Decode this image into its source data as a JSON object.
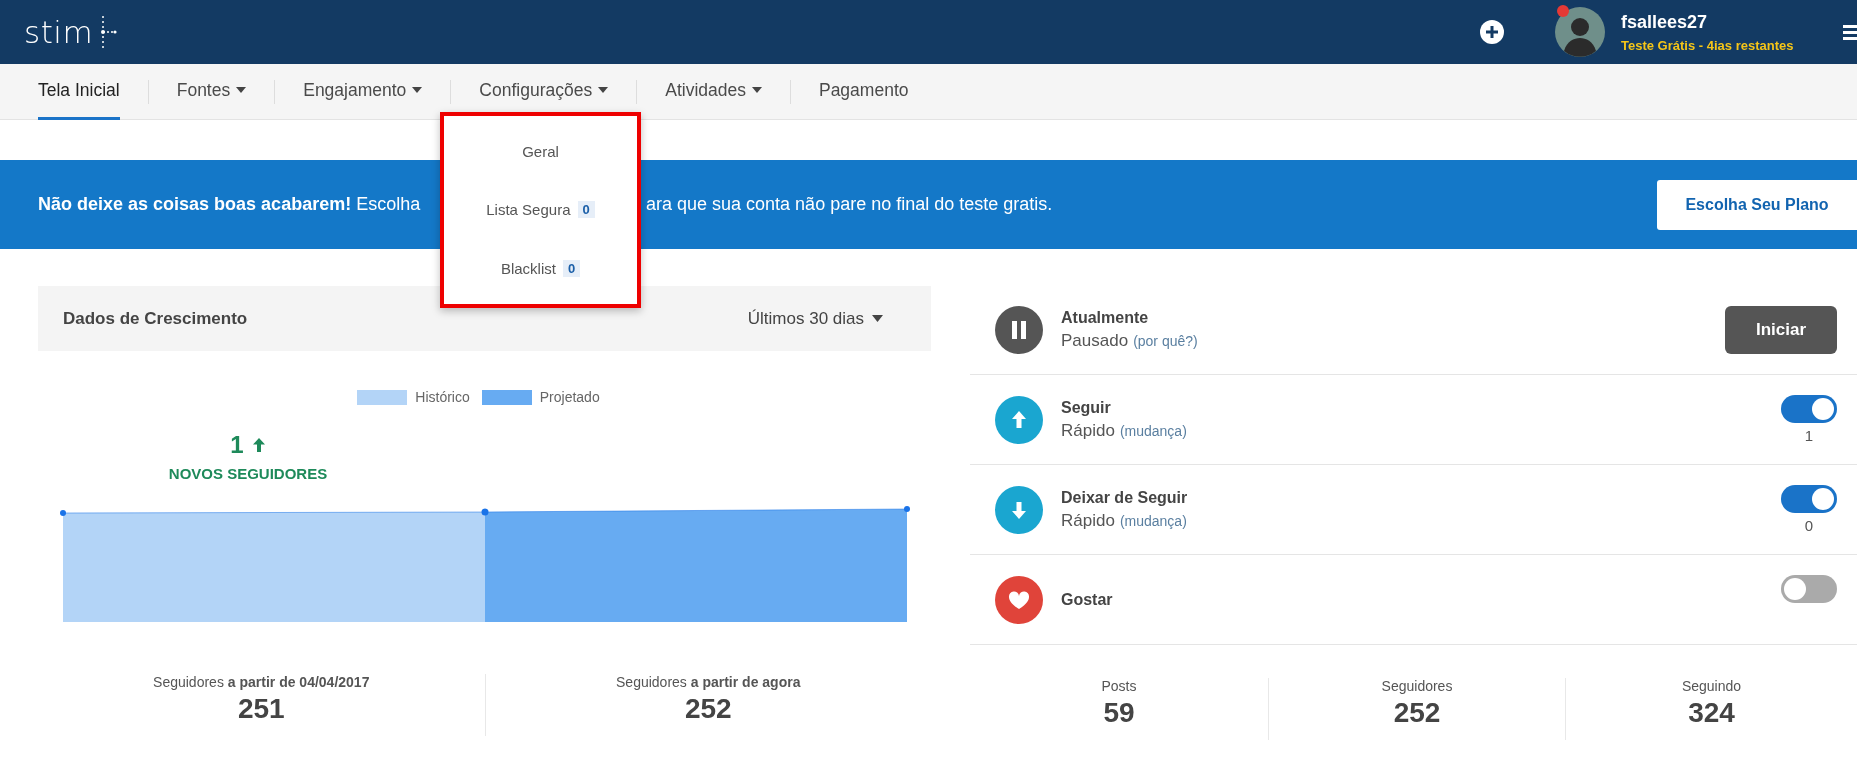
{
  "header": {
    "logo": "stim",
    "user": {
      "name": "fsallees27",
      "trial": "Teste Grátis - 4ias restantes",
      "notification": true
    }
  },
  "nav": {
    "tabs": [
      {
        "label": "Tela Inicial",
        "selected": true,
        "dropdown": false
      },
      {
        "label": "Fontes",
        "selected": false,
        "dropdown": true
      },
      {
        "label": "Engajamento",
        "selected": false,
        "dropdown": true
      },
      {
        "label": "Configurações",
        "selected": false,
        "dropdown": true
      },
      {
        "label": "Atividades",
        "selected": false,
        "dropdown": true
      },
      {
        "label": "Pagamento",
        "selected": false,
        "dropdown": false
      }
    ]
  },
  "dropdown_menu": {
    "items": [
      {
        "label": "Geral"
      },
      {
        "label": "Lista Segura",
        "badge": "0"
      },
      {
        "label": "Blacklist",
        "badge": "0"
      }
    ]
  },
  "banner": {
    "text_start": "**Não deixe as coisas boas acabarem!** Escolha",
    "text_end": "ara que sua conta não pare no final do teste gratis.",
    "button": "Escolha Seu Plano"
  },
  "growth": {
    "title": "Dados de Crescimento",
    "period": "Últimos 30 dias",
    "legend": [
      {
        "label": "Histórico",
        "color": "#b3d4f7"
      },
      {
        "label": "Projetado",
        "color": "#67abf2"
      }
    ],
    "new_count": "1",
    "new_label": "NOVOS SEGUIDORES",
    "stats": [
      {
        "label": "Seguidores **a partir de 04/04/2017**",
        "value": "251"
      },
      {
        "label": "Seguidores **a partir de agora**",
        "value": "252"
      }
    ]
  },
  "activity": {
    "rows": [
      {
        "kind": "status",
        "title": "Atualmente",
        "subtitle": "Pausado",
        "link": "(por quê?)",
        "button": "Iniciar"
      },
      {
        "kind": "toggle",
        "title": "Seguir",
        "subtitle": "Rápido",
        "link": "(mudança)",
        "on": true,
        "count": "1"
      },
      {
        "kind": "toggle",
        "title": "Deixar de Seguir",
        "subtitle": "Rápido",
        "link": "(mudança)",
        "on": true,
        "count": "0"
      },
      {
        "kind": "toggle",
        "title": "Gostar",
        "on": false
      }
    ],
    "stats": [
      {
        "label": "Posts",
        "value": "59"
      },
      {
        "label": "Seguidores",
        "value": "252"
      },
      {
        "label": "Seguindo",
        "value": "324"
      }
    ]
  }
}
